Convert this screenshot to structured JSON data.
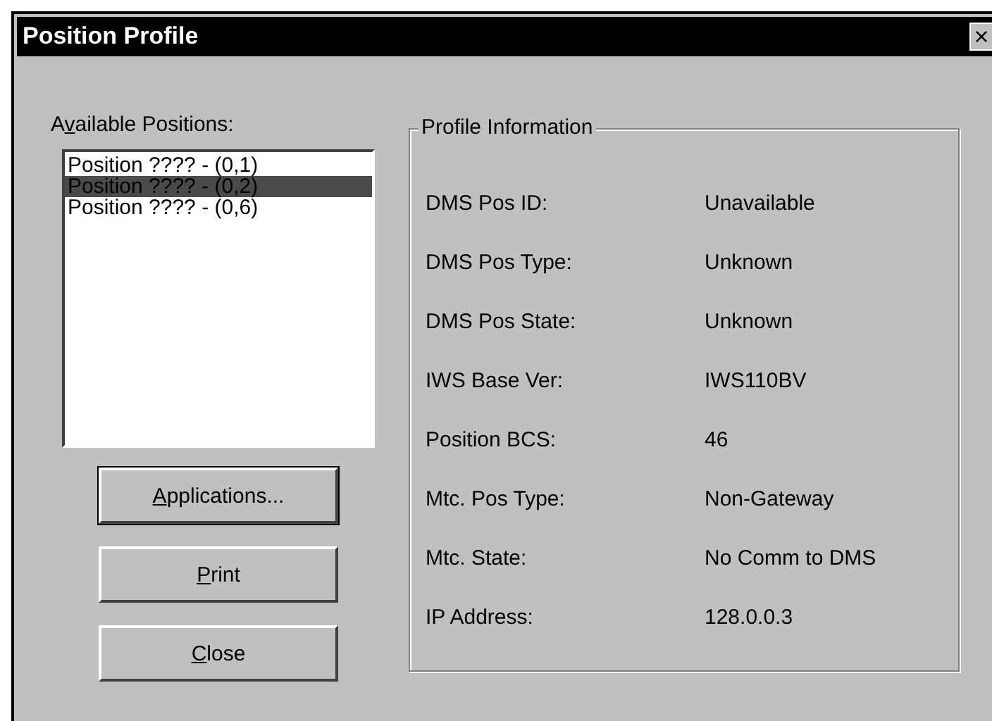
{
  "window": {
    "title": "Position Profile",
    "close": "×"
  },
  "positions": {
    "label": {
      "before": "A",
      "key": "v",
      "after": "ailable Positions:"
    },
    "items": [
      {
        "text": "Position ???? - (0,1)",
        "selected": false
      },
      {
        "text": "Position ???? - (0,2)",
        "selected": true
      },
      {
        "text": "Position ???? - (0,6)",
        "selected": false
      }
    ]
  },
  "buttons": [
    {
      "label": {
        "key": "A",
        "after": "pplications..."
      },
      "default": true
    },
    {
      "label": {
        "key": "P",
        "after": "rint"
      },
      "default": false
    },
    {
      "label": {
        "key": "C",
        "after": "lose"
      },
      "default": false
    }
  ],
  "profile": {
    "title": "Profile Information",
    "fields": [
      {
        "label": "DMS Pos ID:",
        "value": "Unavailable"
      },
      {
        "label": "DMS Pos Type:",
        "value": "Unknown"
      },
      {
        "label": "DMS Pos State:",
        "value": "Unknown"
      },
      {
        "label": "IWS Base Ver:",
        "value": "IWS110BV"
      },
      {
        "label": "Position BCS:",
        "value": "46"
      },
      {
        "label": "Mtc. Pos Type:",
        "value": "Non-Gateway"
      },
      {
        "label": "Mtc. State:",
        "value": "No Comm to DMS"
      },
      {
        "label": "IP Address:",
        "value": "128.0.0.3"
      }
    ]
  }
}
